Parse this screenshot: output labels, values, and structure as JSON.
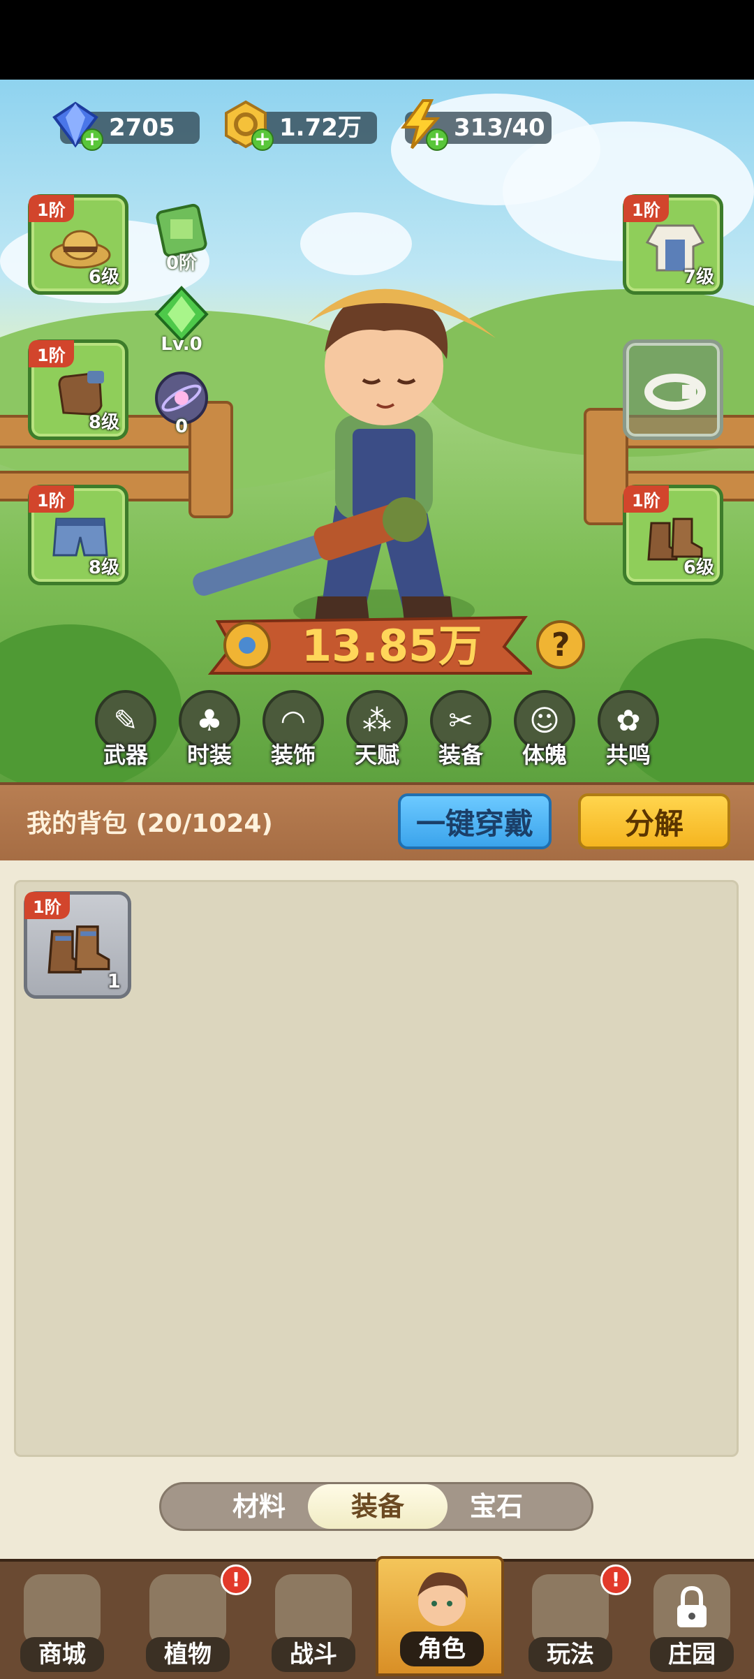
{
  "resources": [
    {
      "name": "diamond-resource",
      "value": "2705",
      "icon": "diamond-icon"
    },
    {
      "name": "coin-resource",
      "value": "1.72万",
      "icon": "coin-icon"
    },
    {
      "name": "energy-resource",
      "value": "313/40",
      "icon": "lightning-icon"
    }
  ],
  "equipment": {
    "hat": {
      "rank": "1阶",
      "level": "6级"
    },
    "gloves": {
      "rank": "1阶",
      "level": "8级"
    },
    "pants": {
      "rank": "1阶",
      "level": "8级"
    },
    "shirt": {
      "rank": "1阶",
      "level": "7级"
    },
    "boots": {
      "rank": "1阶",
      "level": "6级"
    }
  },
  "mini_stats": {
    "card": "0阶",
    "gem": "Lv.0",
    "orb": "0"
  },
  "power": "13.85万",
  "help_label": "?",
  "categories": [
    "武器",
    "时装",
    "装饰",
    "天赋",
    "装备",
    "体魄",
    "共鸣"
  ],
  "bag": {
    "title": "我的背包 (20/1024)",
    "equip_all_label": "一键穿戴",
    "decompose_label": "分解",
    "items": [
      {
        "rank": "1阶",
        "count": "1"
      }
    ]
  },
  "tabs": {
    "materials": "材料",
    "equipment": "装备",
    "gems": "宝石",
    "active": "装备"
  },
  "nav": {
    "shop": "商城",
    "plants": "植物",
    "battle": "战斗",
    "character": "角色",
    "gameplay": "玩法",
    "manor": "庄园",
    "active": "角色",
    "alert_badge": "!"
  }
}
